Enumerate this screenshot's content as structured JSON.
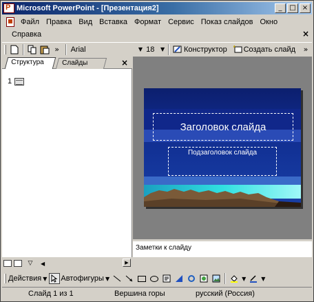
{
  "window": {
    "title": "Microsoft PowerPoint - [Презентация2]",
    "min_glyph": "_",
    "max_glyph": "□",
    "close_glyph": "×"
  },
  "menu": {
    "items": [
      "Файл",
      "Правка",
      "Вид",
      "Вставка",
      "Формат",
      "Сервис",
      "Показ слайдов",
      "Окно"
    ],
    "help": "Справка",
    "close_glyph": "×"
  },
  "toolbar": {
    "font": "Arial",
    "size": "18",
    "designer": "Конструктор",
    "new_slide": "Создать слайд",
    "more_glyph": "»"
  },
  "left_pane": {
    "tab_outline": "Структура",
    "tab_slides": "Слайды",
    "close_glyph": "×",
    "slide_number": "1"
  },
  "slide": {
    "title": "Заголовок слайда",
    "subtitle": "Подзаголовок слайда",
    "colors": {
      "background": "#102a8a",
      "horizon": "#30e0e0",
      "mountains": "#8a6a40"
    }
  },
  "notes": {
    "placeholder": "Заметки к слайду"
  },
  "drawing": {
    "actions": "Действия",
    "autoshapes": "Автофигуры"
  },
  "status": {
    "slide": "Слайд 1 из 1",
    "design": "Вершина горы",
    "language": "русский (Россия)"
  }
}
